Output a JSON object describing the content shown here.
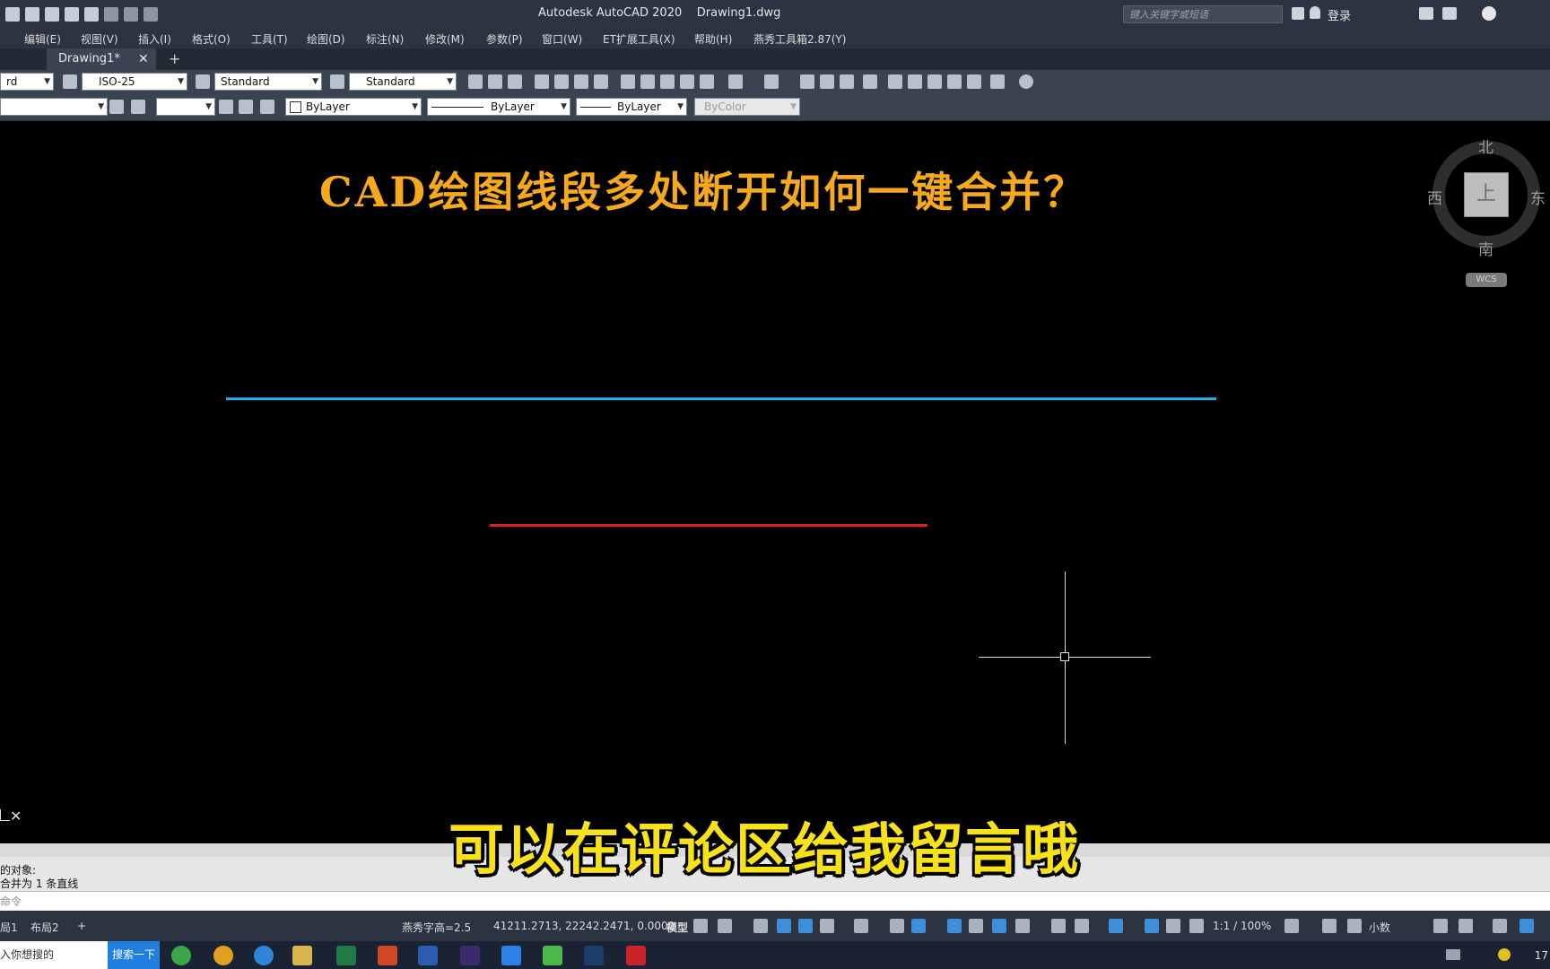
{
  "titlebar": {
    "title": "Autodesk AutoCAD 2020    Drawing1.dwg",
    "search_placeholder": "键入关键字或短语",
    "login_label": "登录"
  },
  "menubar": {
    "items": [
      "编辑(E)",
      "视图(V)",
      "插入(I)",
      "格式(O)",
      "工具(T)",
      "绘图(D)",
      "标注(N)",
      "修改(M)",
      "参数(P)",
      "窗口(W)",
      "ET扩展工具(X)",
      "帮助(H)",
      "燕秀工具箱2.87(Y)"
    ]
  },
  "tabs": {
    "doc_label": "Drawing1*",
    "close_glyph": "✕",
    "add_glyph": "+"
  },
  "toolbar1": {
    "textstyle_value": "rd",
    "dimstyle_value": "ISO-25",
    "tablestyle_value": "Standard",
    "mleaderstyle_value": "Standard"
  },
  "toolbar2": {
    "color_value": "ByLayer",
    "linetype_value": "ByLayer",
    "lineweight_value": "ByLayer",
    "plotstyle_value": "ByColor"
  },
  "canvas": {
    "heading": "CAD绘图线段多处断开如何一键合并？",
    "line_colors": {
      "upper": "#20b4e0",
      "lower": "#e02020"
    },
    "viewcube": {
      "north": "北",
      "south": "南",
      "west": "西",
      "east": "东",
      "face": "上",
      "wcs": "WCS"
    }
  },
  "subtitle": "可以在评论区给我留言哦",
  "command": {
    "history_line1": "的对象:",
    "history_line2": "合并为 1 条直线",
    "input_placeholder": "命令"
  },
  "statusbar": {
    "tab1": "局1",
    "tab2": "布局2",
    "add": "+",
    "text_height": "燕秀字高=2.5",
    "coords": "41211.2713, 22242.2471, 0.0000",
    "model": "模型",
    "scale": "1:1 / 100%",
    "units": "小数"
  },
  "taskbar": {
    "search_text": "入你想搜的",
    "search_button": "搜索一下",
    "clock": "17"
  }
}
